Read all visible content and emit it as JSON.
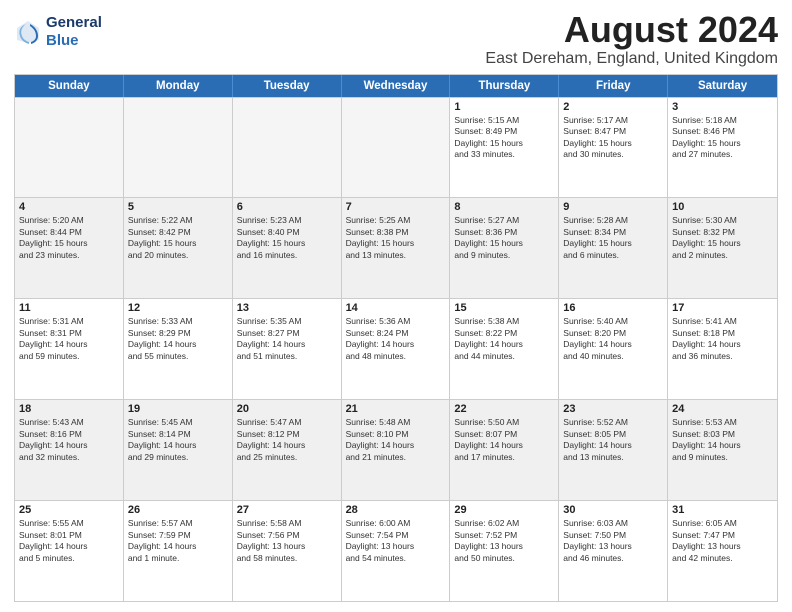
{
  "logo": {
    "line1": "General",
    "line2": "Blue"
  },
  "title": "August 2024",
  "subtitle": "East Dereham, England, United Kingdom",
  "weekdays": [
    "Sunday",
    "Monday",
    "Tuesday",
    "Wednesday",
    "Thursday",
    "Friday",
    "Saturday"
  ],
  "weeks": [
    [
      {
        "day": "",
        "info": "",
        "empty": true
      },
      {
        "day": "",
        "info": "",
        "empty": true
      },
      {
        "day": "",
        "info": "",
        "empty": true
      },
      {
        "day": "",
        "info": "",
        "empty": true
      },
      {
        "day": "1",
        "info": "Sunrise: 5:15 AM\nSunset: 8:49 PM\nDaylight: 15 hours\nand 33 minutes."
      },
      {
        "day": "2",
        "info": "Sunrise: 5:17 AM\nSunset: 8:47 PM\nDaylight: 15 hours\nand 30 minutes."
      },
      {
        "day": "3",
        "info": "Sunrise: 5:18 AM\nSunset: 8:46 PM\nDaylight: 15 hours\nand 27 minutes."
      }
    ],
    [
      {
        "day": "4",
        "info": "Sunrise: 5:20 AM\nSunset: 8:44 PM\nDaylight: 15 hours\nand 23 minutes."
      },
      {
        "day": "5",
        "info": "Sunrise: 5:22 AM\nSunset: 8:42 PM\nDaylight: 15 hours\nand 20 minutes."
      },
      {
        "day": "6",
        "info": "Sunrise: 5:23 AM\nSunset: 8:40 PM\nDaylight: 15 hours\nand 16 minutes."
      },
      {
        "day": "7",
        "info": "Sunrise: 5:25 AM\nSunset: 8:38 PM\nDaylight: 15 hours\nand 13 minutes."
      },
      {
        "day": "8",
        "info": "Sunrise: 5:27 AM\nSunset: 8:36 PM\nDaylight: 15 hours\nand 9 minutes."
      },
      {
        "day": "9",
        "info": "Sunrise: 5:28 AM\nSunset: 8:34 PM\nDaylight: 15 hours\nand 6 minutes."
      },
      {
        "day": "10",
        "info": "Sunrise: 5:30 AM\nSunset: 8:32 PM\nDaylight: 15 hours\nand 2 minutes."
      }
    ],
    [
      {
        "day": "11",
        "info": "Sunrise: 5:31 AM\nSunset: 8:31 PM\nDaylight: 14 hours\nand 59 minutes."
      },
      {
        "day": "12",
        "info": "Sunrise: 5:33 AM\nSunset: 8:29 PM\nDaylight: 14 hours\nand 55 minutes."
      },
      {
        "day": "13",
        "info": "Sunrise: 5:35 AM\nSunset: 8:27 PM\nDaylight: 14 hours\nand 51 minutes."
      },
      {
        "day": "14",
        "info": "Sunrise: 5:36 AM\nSunset: 8:24 PM\nDaylight: 14 hours\nand 48 minutes."
      },
      {
        "day": "15",
        "info": "Sunrise: 5:38 AM\nSunset: 8:22 PM\nDaylight: 14 hours\nand 44 minutes."
      },
      {
        "day": "16",
        "info": "Sunrise: 5:40 AM\nSunset: 8:20 PM\nDaylight: 14 hours\nand 40 minutes."
      },
      {
        "day": "17",
        "info": "Sunrise: 5:41 AM\nSunset: 8:18 PM\nDaylight: 14 hours\nand 36 minutes."
      }
    ],
    [
      {
        "day": "18",
        "info": "Sunrise: 5:43 AM\nSunset: 8:16 PM\nDaylight: 14 hours\nand 32 minutes."
      },
      {
        "day": "19",
        "info": "Sunrise: 5:45 AM\nSunset: 8:14 PM\nDaylight: 14 hours\nand 29 minutes."
      },
      {
        "day": "20",
        "info": "Sunrise: 5:47 AM\nSunset: 8:12 PM\nDaylight: 14 hours\nand 25 minutes."
      },
      {
        "day": "21",
        "info": "Sunrise: 5:48 AM\nSunset: 8:10 PM\nDaylight: 14 hours\nand 21 minutes."
      },
      {
        "day": "22",
        "info": "Sunrise: 5:50 AM\nSunset: 8:07 PM\nDaylight: 14 hours\nand 17 minutes."
      },
      {
        "day": "23",
        "info": "Sunrise: 5:52 AM\nSunset: 8:05 PM\nDaylight: 14 hours\nand 13 minutes."
      },
      {
        "day": "24",
        "info": "Sunrise: 5:53 AM\nSunset: 8:03 PM\nDaylight: 14 hours\nand 9 minutes."
      }
    ],
    [
      {
        "day": "25",
        "info": "Sunrise: 5:55 AM\nSunset: 8:01 PM\nDaylight: 14 hours\nand 5 minutes."
      },
      {
        "day": "26",
        "info": "Sunrise: 5:57 AM\nSunset: 7:59 PM\nDaylight: 14 hours\nand 1 minute."
      },
      {
        "day": "27",
        "info": "Sunrise: 5:58 AM\nSunset: 7:56 PM\nDaylight: 13 hours\nand 58 minutes."
      },
      {
        "day": "28",
        "info": "Sunrise: 6:00 AM\nSunset: 7:54 PM\nDaylight: 13 hours\nand 54 minutes."
      },
      {
        "day": "29",
        "info": "Sunrise: 6:02 AM\nSunset: 7:52 PM\nDaylight: 13 hours\nand 50 minutes."
      },
      {
        "day": "30",
        "info": "Sunrise: 6:03 AM\nSunset: 7:50 PM\nDaylight: 13 hours\nand 46 minutes."
      },
      {
        "day": "31",
        "info": "Sunrise: 6:05 AM\nSunset: 7:47 PM\nDaylight: 13 hours\nand 42 minutes."
      }
    ]
  ]
}
